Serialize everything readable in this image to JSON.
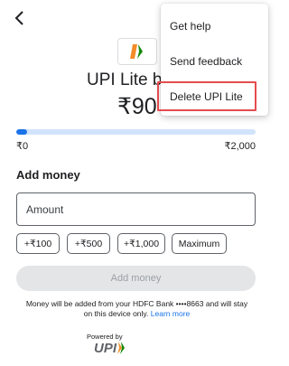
{
  "header": {
    "back_icon": "arrow-back-icon",
    "title": "UPI Lite bala"
  },
  "logo": {
    "icon": "upi-lite-logo-icon",
    "colors": [
      "#f28c28",
      "#138808"
    ]
  },
  "balance": {
    "amount": "₹90",
    "progress_fraction": 0.045,
    "min_label": "₹0",
    "max_label": "₹2,000",
    "fill_color": "#1a73e8",
    "track_color": "#d2e3fc"
  },
  "add_money": {
    "section_title": "Add money",
    "amount_placeholder": "Amount",
    "chips": [
      "+₹100",
      "+₹500",
      "+₹1,000",
      "Maximum"
    ],
    "button_label": "Add money"
  },
  "info": {
    "text": "Money will be added from your HDFC Bank ••••8663 and will stay on this device only.",
    "link_label": "Learn more"
  },
  "footer": {
    "powered_by": "Powered by",
    "brand_icon": "upi-brand-logo"
  },
  "menu": {
    "items": [
      "Get help",
      "Send feedback",
      "Delete UPI Lite"
    ],
    "highlight_color": "#e44c4f"
  }
}
